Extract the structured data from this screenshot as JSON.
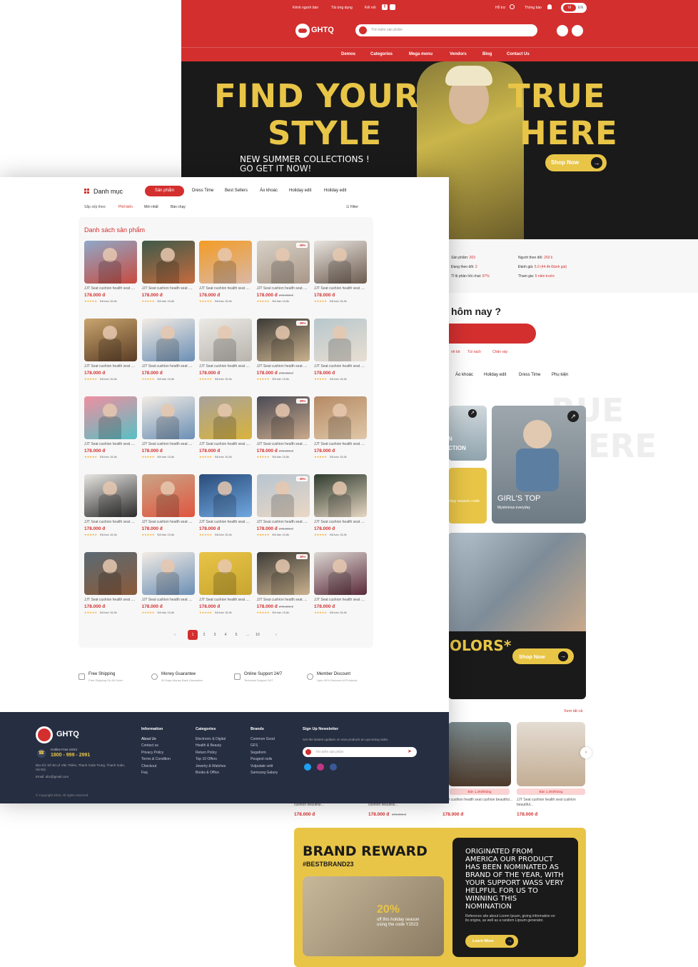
{
  "back": {
    "topbar": {
      "left_links": [
        "Kênh người bán",
        "Tải ứng dụng",
        "Kết nối"
      ],
      "help": "Hỗ trợ",
      "notify": "Thông báo",
      "lang_vi": "VI",
      "lang_en": "EN"
    },
    "header": {
      "logo": "GHTQ",
      "search_placeholder": "Tìm kiếm sản phẩm"
    },
    "nav": [
      "Demos",
      "Categories",
      "Mega menu",
      "Vendors",
      "Blog",
      "Contact Us"
    ],
    "hero": {
      "line1a": "FIND YOUR",
      "line1b": "TRUE",
      "line2a": "STYLE",
      "line2b": "HERE",
      "sub1": "NEW SUMMER COLLECTIONS !",
      "sub2": "GO GET IT NOW!",
      "cta": "Shop Now"
    },
    "stats": {
      "products_label": "Sản phẩm:",
      "products": "203",
      "following_label": "Đang theo dõi:",
      "following": "2",
      "response_label": "Tỉ lệ phản hồi chat:",
      "response": "97%",
      "followers_label": "Người theo dõi:",
      "followers": "203 k",
      "rating_label": "Đánh giá:",
      "rating": "5.0 (44.4k Đánh giá)",
      "joined_label": "Tham gia:",
      "joined": "5 năm trước"
    },
    "today_title": "hôm nay ?",
    "small_links": [
      "nh bò",
      "Túi xách",
      "Chân váy"
    ],
    "tabs": [
      "Áo khoác",
      "Holiday edit",
      "Dress Time",
      "Phụ kiện"
    ],
    "watermark1": "RUE",
    "watermark2": "ERE",
    "tile_left_text": "CTION",
    "tile_left_text2": "N",
    "tile_yellow_text": "liday season code",
    "girls_top": "GIRL'S TOP",
    "girls_top_sub": "Mysterious everyday",
    "colors": "OLORS*",
    "colors_cta": "Shop Now",
    "see_all": "Xem tất cả",
    "sold_badge": "Bán 1,293/tháng",
    "bottom_products": [
      {
        "name": "cushion beautiful...",
        "price": "178.000 đ",
        "old": ""
      },
      {
        "name": "cushion beautiful...",
        "price": "178.000 đ",
        "old": "278.000 đ"
      },
      {
        "name": "Seat cushion health seat cushion beautiful...",
        "price": "178.000 đ",
        "old": ""
      },
      {
        "name": "JJT Seat cushion health seat cushion beautiful...",
        "price": "178.000 đ",
        "old": ""
      }
    ],
    "reward": {
      "title": "BRAND REWARD",
      "tag": "#BESTBRAND23",
      "pct": "20%",
      "pct_sub": "off this holiday season using the code Y2023",
      "story": "ORIGINATED FROM AMERICA OUR PRODUCT HAS BEEN NOMINATED AS BRAND OF THE YEAR, WITH YOUR SUPPORT WASS VERY HELPFUL FOR US TO WINNING THIS NOMINATION",
      "story_small": "Reference site about Lorem Ipsum, giving information on its origins, as well as a random Lipsum generator.",
      "cta": "Learn More"
    }
  },
  "front": {
    "category_label": "Danh mục",
    "tabs": [
      "Sản phẩm",
      "Dress Time",
      "Best Sellers",
      "Áo khoác",
      "Holiday edit",
      "Holiday edit"
    ],
    "sort_label": "Sắp xếp theo:",
    "sort_options": [
      "Phổ biến",
      "Mới nhất",
      "Bán chạy"
    ],
    "filter": "Filter",
    "list_title": "Danh sách sản phẩm",
    "product": {
      "name": "JJT Seat cushion health seat ....",
      "price": "178.000 đ",
      "old": "278.000 đ",
      "sold": "Đã bán 15,8k",
      "discount": "- 39%"
    },
    "pagination": [
      "‹",
      "1",
      "2",
      "3",
      "4",
      "5",
      "...",
      "10",
      "›"
    ],
    "features": [
      {
        "title": "Free Shipping",
        "sub": "Free Shipping On All Order"
      },
      {
        "title": "Money Guarantee",
        "sub": "30 Days Money Back Guarantee"
      },
      {
        "title": "Online Support 24/7",
        "sub": "Technical Support 24/7"
      },
      {
        "title": "Member Discount",
        "sub": "Upto 40% Discount All Products"
      }
    ],
    "footer": {
      "logo": "GHTQ",
      "hotline_label": "Hotline Free 24/24",
      "hotline": "1800 - 999 - 2991",
      "address": "Địa chỉ: Số 30 Lê Văn Thiêm, Thanh Xuân Trung, Thanh Xuân, Hà Nội",
      "email": "Email: abc@gmail.com",
      "info_title": "Information",
      "info": [
        "About Us",
        "Contact us",
        "Privacy Policy",
        "Terms & Condition",
        "Checkout",
        "Faq"
      ],
      "cat_title": "Categories",
      "cats": [
        "Electronic & Digital",
        "Health & Beauty",
        "Return Policy",
        "Top 10 Offers",
        "Jewelry & Watches",
        "Books & Office"
      ],
      "brand_title": "Brands",
      "brands": [
        "Common Good",
        "GFS",
        "Segaform",
        "Peugeot nolis",
        "Vulputate velit",
        "Samsung Galaxy"
      ],
      "news_title": "Sign Up Newsletter",
      "news_sub": "Get the lastest updates on new products an upcoming sales",
      "news_placeholder": "Tìm kiếm sản phẩm",
      "copyright": "© Copyright 2023, All rights reserved"
    }
  },
  "colors": {
    "red": "#d32f2f",
    "yellow": "#e8c547",
    "dark": "#1a1a1a",
    "footer": "#262e42"
  }
}
